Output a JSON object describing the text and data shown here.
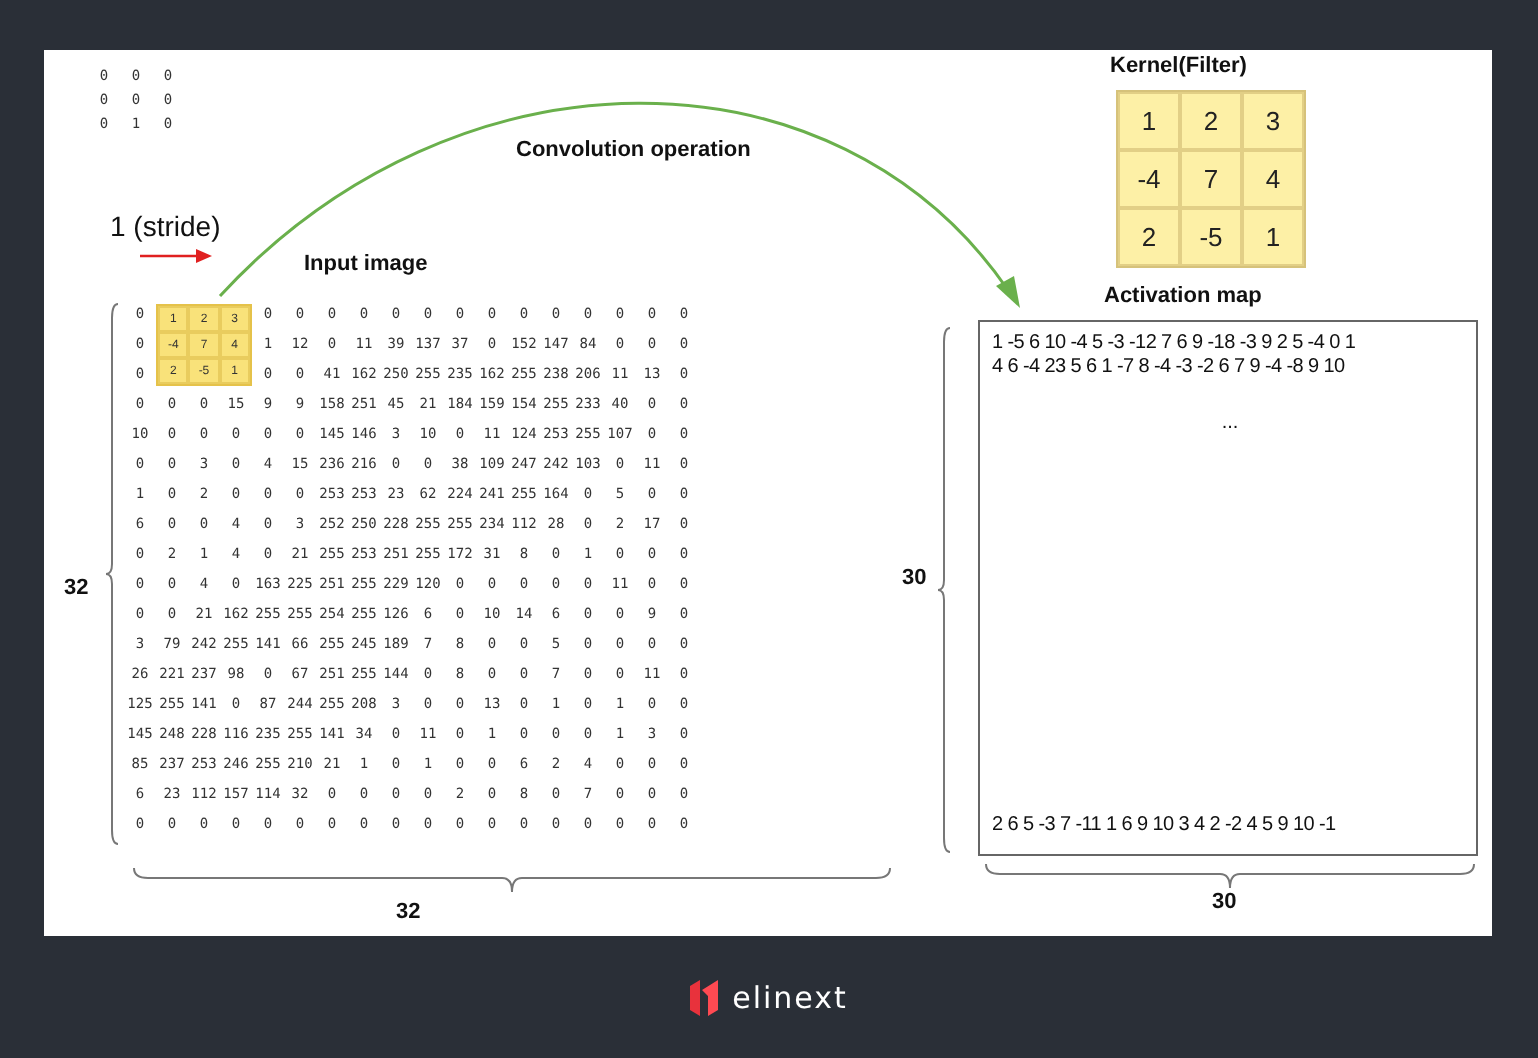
{
  "corner_matrix": {
    "rows": [
      [
        "0",
        "0",
        "0"
      ],
      [
        "0",
        "0",
        "0"
      ],
      [
        "0",
        "1",
        "0"
      ]
    ]
  },
  "stride": {
    "label": "1 (stride)"
  },
  "operation_label": "Convolution operation",
  "input_image": {
    "title": "Input image",
    "height_label": "32",
    "width_label": "32",
    "kernel_overlay": [
      [
        "1",
        "2",
        "3"
      ],
      [
        "-4",
        "7",
        "4"
      ],
      [
        "2",
        "-5",
        "1"
      ]
    ],
    "rows": [
      [
        "0",
        "0",
        "0",
        "0",
        "0",
        "0",
        "0",
        "0",
        "0",
        "0",
        "0",
        "0",
        "0",
        "0",
        "0"
      ],
      [
        "0",
        "1",
        "12",
        "0",
        "11",
        "39",
        "137",
        "37",
        "0",
        "152",
        "147",
        "84",
        "0",
        "0",
        "0"
      ],
      [
        "0",
        "0",
        "0",
        "41",
        "162",
        "250",
        "255",
        "235",
        "162",
        "255",
        "238",
        "206",
        "11",
        "13",
        "0"
      ],
      [
        "0",
        "0",
        "0",
        "15",
        "9",
        "9",
        "158",
        "251",
        "45",
        "21",
        "184",
        "159",
        "154",
        "255",
        "233",
        "40",
        "0",
        "0"
      ],
      [
        "10",
        "0",
        "0",
        "0",
        "0",
        "0",
        "145",
        "146",
        "3",
        "10",
        "0",
        "11",
        "124",
        "253",
        "255",
        "107",
        "0",
        "0"
      ],
      [
        "0",
        "0",
        "3",
        "0",
        "4",
        "15",
        "236",
        "216",
        "0",
        "0",
        "38",
        "109",
        "247",
        "242",
        "103",
        "0",
        "11",
        "0"
      ],
      [
        "1",
        "0",
        "2",
        "0",
        "0",
        "0",
        "253",
        "253",
        "23",
        "62",
        "224",
        "241",
        "255",
        "164",
        "0",
        "5",
        "0",
        "0"
      ],
      [
        "6",
        "0",
        "0",
        "4",
        "0",
        "3",
        "252",
        "250",
        "228",
        "255",
        "255",
        "234",
        "112",
        "28",
        "0",
        "2",
        "17",
        "0"
      ],
      [
        "0",
        "2",
        "1",
        "4",
        "0",
        "21",
        "255",
        "253",
        "251",
        "255",
        "172",
        "31",
        "8",
        "0",
        "1",
        "0",
        "0",
        "0"
      ],
      [
        "0",
        "0",
        "4",
        "0",
        "163",
        "225",
        "251",
        "255",
        "229",
        "120",
        "0",
        "0",
        "0",
        "0",
        "0",
        "11",
        "0",
        "0"
      ],
      [
        "0",
        "0",
        "21",
        "162",
        "255",
        "255",
        "254",
        "255",
        "126",
        "6",
        "0",
        "10",
        "14",
        "6",
        "0",
        "0",
        "9",
        "0"
      ],
      [
        "3",
        "79",
        "242",
        "255",
        "141",
        "66",
        "255",
        "245",
        "189",
        "7",
        "8",
        "0",
        "0",
        "5",
        "0",
        "0",
        "0",
        "0"
      ],
      [
        "26",
        "221",
        "237",
        "98",
        "0",
        "67",
        "251",
        "255",
        "144",
        "0",
        "8",
        "0",
        "0",
        "7",
        "0",
        "0",
        "11",
        "0"
      ],
      [
        "125",
        "255",
        "141",
        "0",
        "87",
        "244",
        "255",
        "208",
        "3",
        "0",
        "0",
        "13",
        "0",
        "1",
        "0",
        "1",
        "0",
        "0"
      ],
      [
        "145",
        "248",
        "228",
        "116",
        "235",
        "255",
        "141",
        "34",
        "0",
        "11",
        "0",
        "1",
        "0",
        "0",
        "0",
        "1",
        "3",
        "0"
      ],
      [
        "85",
        "237",
        "253",
        "246",
        "255",
        "210",
        "21",
        "1",
        "0",
        "1",
        "0",
        "0",
        "6",
        "2",
        "4",
        "0",
        "0",
        "0"
      ],
      [
        "6",
        "23",
        "112",
        "157",
        "114",
        "32",
        "0",
        "0",
        "0",
        "0",
        "2",
        "0",
        "8",
        "0",
        "7",
        "0",
        "0",
        "0"
      ],
      [
        "0",
        "0",
        "0",
        "0",
        "0",
        "0",
        "0",
        "0",
        "0",
        "0",
        "0",
        "0",
        "0",
        "0",
        "0",
        "0",
        "0",
        "0"
      ]
    ]
  },
  "kernel": {
    "title": "Kernel(Filter)",
    "rows": [
      [
        "1",
        "2",
        "3"
      ],
      [
        "-4",
        "7",
        "4"
      ],
      [
        "2",
        "-5",
        "1"
      ]
    ]
  },
  "activation_map": {
    "title": "Activation map",
    "height_label": "30",
    "width_label": "30",
    "lines": [
      "1 -5 6 10 -4 5 -3 -12 7 6 9 -18 -3 9 2 5 -4 0 1",
      "4 6 -4 23 5 6 1 -7 8 -4 -3 -2 6 7 9 -4 -8 9 10"
    ],
    "ellipsis": "...",
    "last_line": "2 6 5 -3 7 -11 1 6 9 10 3 4 2 -2 4 5 9 10 -1"
  },
  "footer": {
    "brand": "elinext"
  }
}
